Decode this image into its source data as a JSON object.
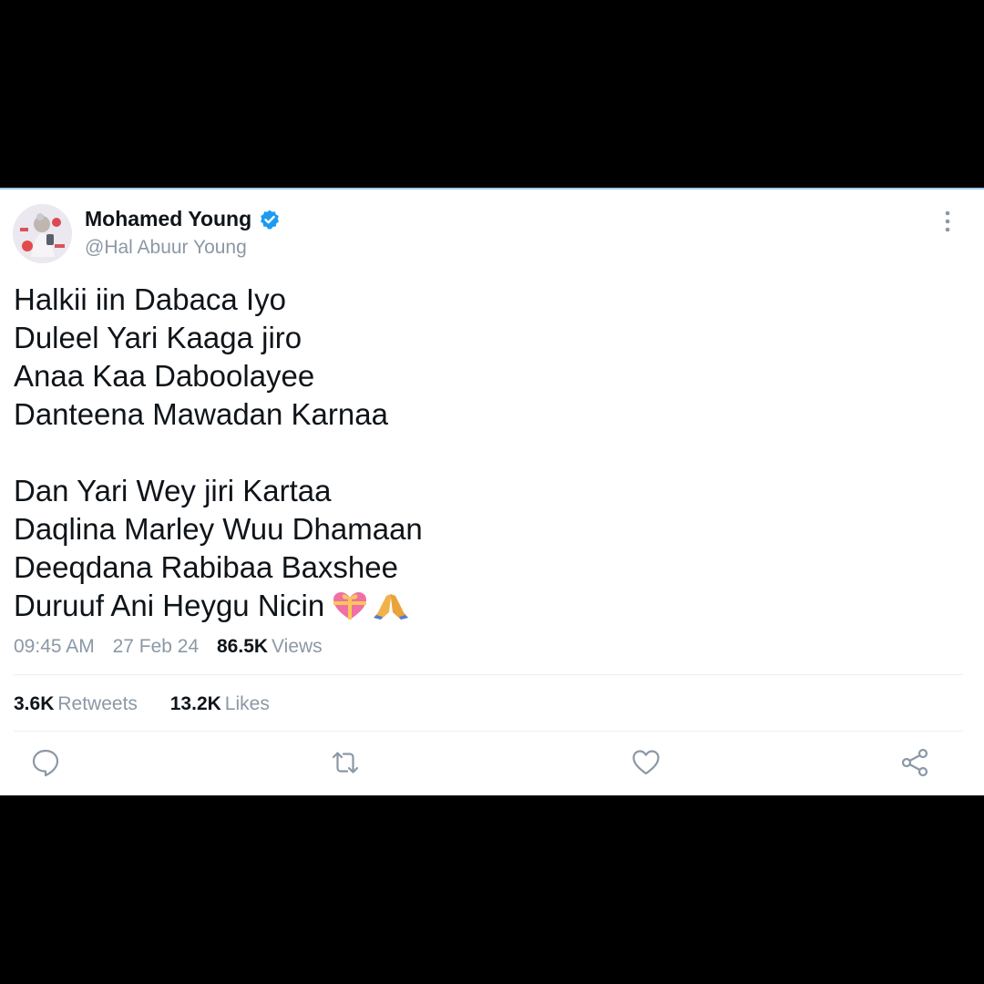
{
  "tweet": {
    "author": {
      "display_name": "Mohamed Young",
      "handle": "@Hal Abuur Young",
      "verified": true
    },
    "text_lines": [
      "Halkii iin Dabaca Iyo",
      "Duleel Yari Kaaga jiro",
      "Anaa Kaa Daboolayee",
      "Danteena Mawadan Karnaa",
      "",
      "Dan Yari Wey jiri Kartaa",
      "Daqlina Marley Wuu Dhamaan",
      "Deeqdana Rabibaa Baxshee",
      "Duruuf Ani Heygu Nicin"
    ],
    "emojis": [
      "💖",
      "🙏"
    ],
    "time": "09:45 AM",
    "date": "27 Feb 24",
    "views_count": "86.5K",
    "views_label": "Views",
    "retweets_count": "3.6K",
    "retweets_label": "Retweets",
    "likes_count": "13.2K",
    "likes_label": "Likes"
  },
  "icons": {
    "verified": "verified-badge-icon",
    "more": "more-vertical-icon",
    "reply": "reply-icon",
    "retweet": "retweet-icon",
    "like": "heart-icon",
    "share": "share-icon"
  },
  "colors": {
    "background": "#000000",
    "card": "#ffffff",
    "text": "#0f1419",
    "secondary_text": "#8b98a5",
    "verified_blue": "#1d9bf0",
    "icon_gray": "#8b98a5",
    "card_top_border": "#9fc9ec"
  }
}
